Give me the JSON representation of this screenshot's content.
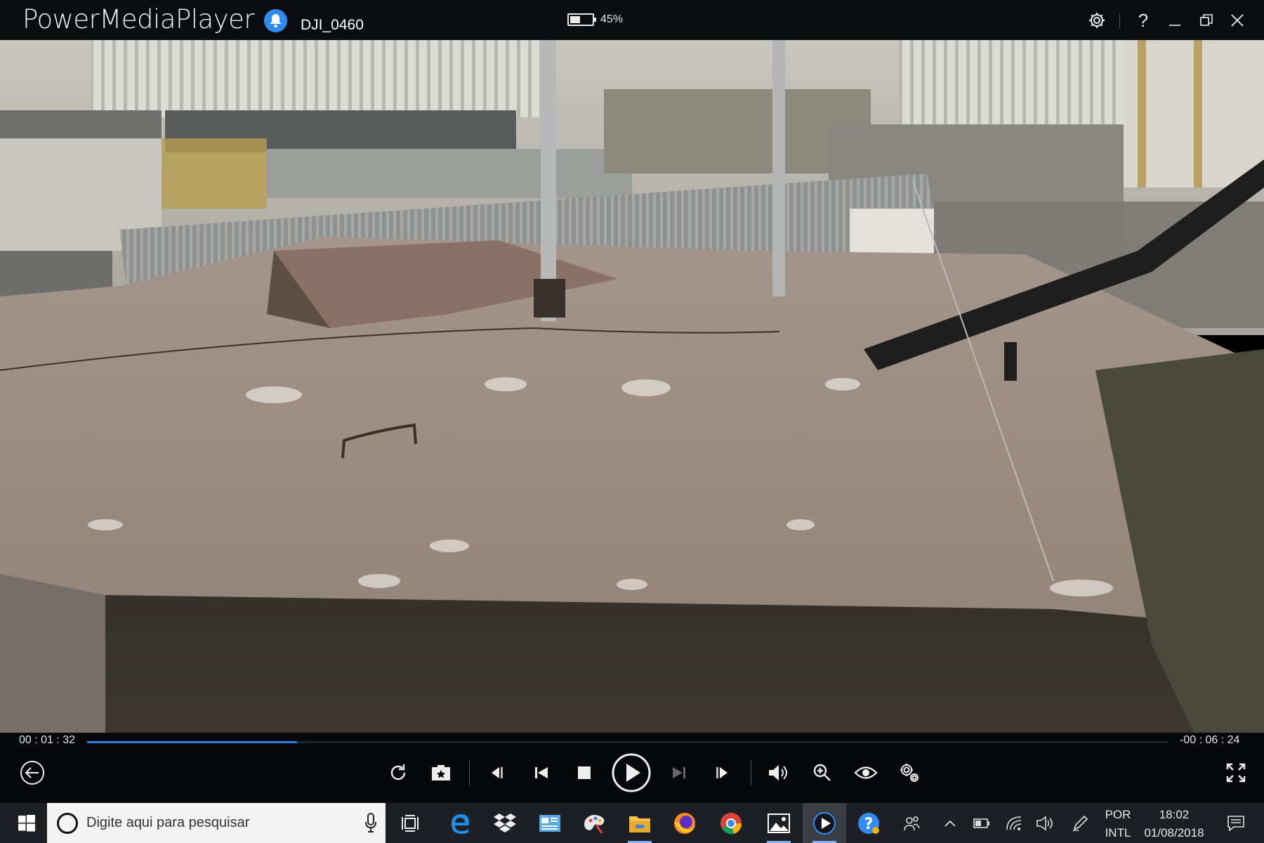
{
  "app": {
    "name": "PowerMediaPlayer",
    "file_name": "DJI_0460"
  },
  "battery": {
    "percent_text": "45%",
    "level": 0.45
  },
  "titlebar_icons": [
    "gear-icon",
    "help-icon",
    "minimize-icon",
    "restore-icon",
    "close-icon"
  ],
  "help_label": "?",
  "playback": {
    "elapsed": "00 : 01 : 32",
    "remaining": "-00 : 06 : 24",
    "progress": 0.194
  },
  "controls": [
    "back-icon",
    "rotate-icon",
    "snapshot-icon",
    "frame-back-icon",
    "previous-icon",
    "stop-icon",
    "play-icon",
    "next-icon",
    "frame-forward-icon",
    "volume-icon",
    "zoom-in-icon",
    "eye-icon",
    "settings-icon",
    "fullscreen-icon"
  ],
  "taskbar": {
    "search_placeholder": "Digite aqui para pesquisar",
    "apps": [
      "task-view",
      "edge",
      "dropbox",
      "mail-reader",
      "paint-3d",
      "file-explorer",
      "firefox",
      "chrome",
      "photos",
      "powermediaplayer",
      "help"
    ],
    "language_top": "POR",
    "language_bottom": "INTL",
    "time": "18:02",
    "date": "01/08/2018"
  },
  "colors": {
    "accent": "#2f7fe0",
    "bell": "#2f8df2",
    "titlebar": "#0b0c10",
    "taskbar": "#1d1f24"
  }
}
